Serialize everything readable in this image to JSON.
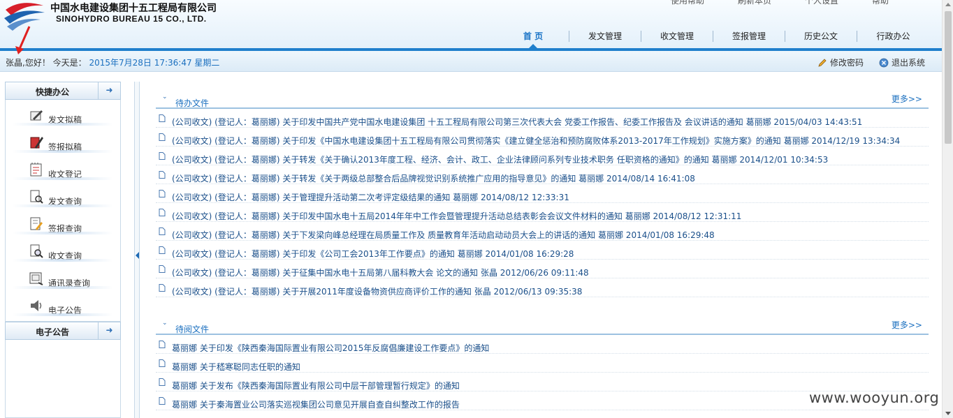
{
  "header": {
    "company_cn": "中国水电建设集团十五工程局有限公司",
    "company_en": "SINOHYDRO BUREAU 15 CO., LTD.",
    "top_links": [
      "使用帮助",
      "刷新本页",
      "个人设置",
      "帮助"
    ],
    "nav": [
      {
        "label": "首 页",
        "active": true
      },
      {
        "label": "发文管理",
        "active": false
      },
      {
        "label": "收文管理",
        "active": false
      },
      {
        "label": "签报管理",
        "active": false
      },
      {
        "label": "历史公文",
        "active": false
      },
      {
        "label": "行政办公",
        "active": false
      }
    ]
  },
  "infobar": {
    "greeting": "张晶,您好！ 今天是：",
    "datetime": "2015年7月28日 17:36:47 星期二",
    "change_password": "修改密码",
    "logout": "退出系统"
  },
  "sidebar": {
    "quick_title": "快捷办公",
    "quick_items": [
      {
        "label": "发文拟稿",
        "icon": "pen-paper-icon"
      },
      {
        "label": "签报拟稿",
        "icon": "pen-book-icon"
      },
      {
        "label": "收文登记",
        "icon": "notepad-icon"
      },
      {
        "label": "发文查询",
        "icon": "document-search-icon"
      },
      {
        "label": "签报查询",
        "icon": "document-edit-icon"
      },
      {
        "label": "收文查询",
        "icon": "document-magnify-icon"
      },
      {
        "label": "通讯录查询",
        "icon": "contacts-icon"
      },
      {
        "label": "电子公告",
        "icon": "speaker-icon"
      }
    ],
    "notice_title": "电子公告"
  },
  "pending": {
    "title": "待办文件",
    "more": "更多>>",
    "items": [
      "(公司收文) (登记人：葛丽娜) 关于印发中国共产党中国水电建设集团 十五工程局有限公司第三次代表大会 党委工作报告、纪委工作报告及 会议讲话的通知 葛丽娜 2015/04/03 14:43:51",
      "(公司收文) (登记人：葛丽娜) 关于印发《中国水电建设集团十五工程局有限公司贯彻落实《建立健全惩治和预防腐败体系2013-2017年工作规划》实施方案》的通知 葛丽娜 2014/12/19 13:34:34",
      "(公司收文) (登记人：葛丽娜) 关于转发《关于确认2013年度工程、经济、会计、政工、企业法律顾问系列专业技术职务 任职资格的通知》的通知 葛丽娜 2014/12/01 10:34:53",
      "(公司收文) (登记人：葛丽娜) 关于转发《关于两级总部整合后品牌视觉识别系统推广应用的指导意见》的通知 葛丽娜 2014/08/14 16:41:08",
      "(公司收文) (登记人：葛丽娜) 关于管理提升活动第二次考评定级结果的通知 葛丽娜 2014/08/12 12:33:31",
      "(公司收文) (登记人：葛丽娜) 关于印发中国水电十五局2014年年中工作会暨管理提升活动总结表彰会会议文件材料的通知 葛丽娜 2014/08/12 12:31:11",
      "(公司收文) (登记人：葛丽娜) 关于下发梁向峰总经理在局质量工作及 质量教育年活动启动动员大会上的讲话的通知 葛丽娜 2014/01/08 16:29:48",
      "(公司收文) (登记人：葛丽娜) 关于印发《公司工会2013年工作要点》的通知 葛丽娜 2014/01/08 16:29:28",
      "(公司收文) (登记人：葛丽娜) 关于征集中国水电十五局第八届科教大会 论文的通知 张晶 2012/06/26 09:11:48",
      "(公司收文) (登记人：葛丽娜) 关于开展2011年度设备物资供应商评价工作的通知 张晶 2012/06/13 09:35:38"
    ]
  },
  "toread": {
    "title": "待阅文件",
    "more": "更多>>",
    "items": [
      "葛丽娜 关于印发《陕西秦海国际置业有限公司2015年反腐倡廉建设工作要点》的通知",
      "葛丽娜 关于嵇寒聪同志任职的通知",
      "葛丽娜 关于发布《陕西秦海国际置业有限公司中层干部管理暂行规定》的通知",
      "葛丽娜 关于秦海置业公司落实巡视集团公司意见开展自查自纠整改工作的报告"
    ]
  },
  "watermark": "www.wooyun.org",
  "colors": {
    "accent": "#1f7fcc",
    "link": "#1a4f8a",
    "arrow": "#e02020"
  }
}
